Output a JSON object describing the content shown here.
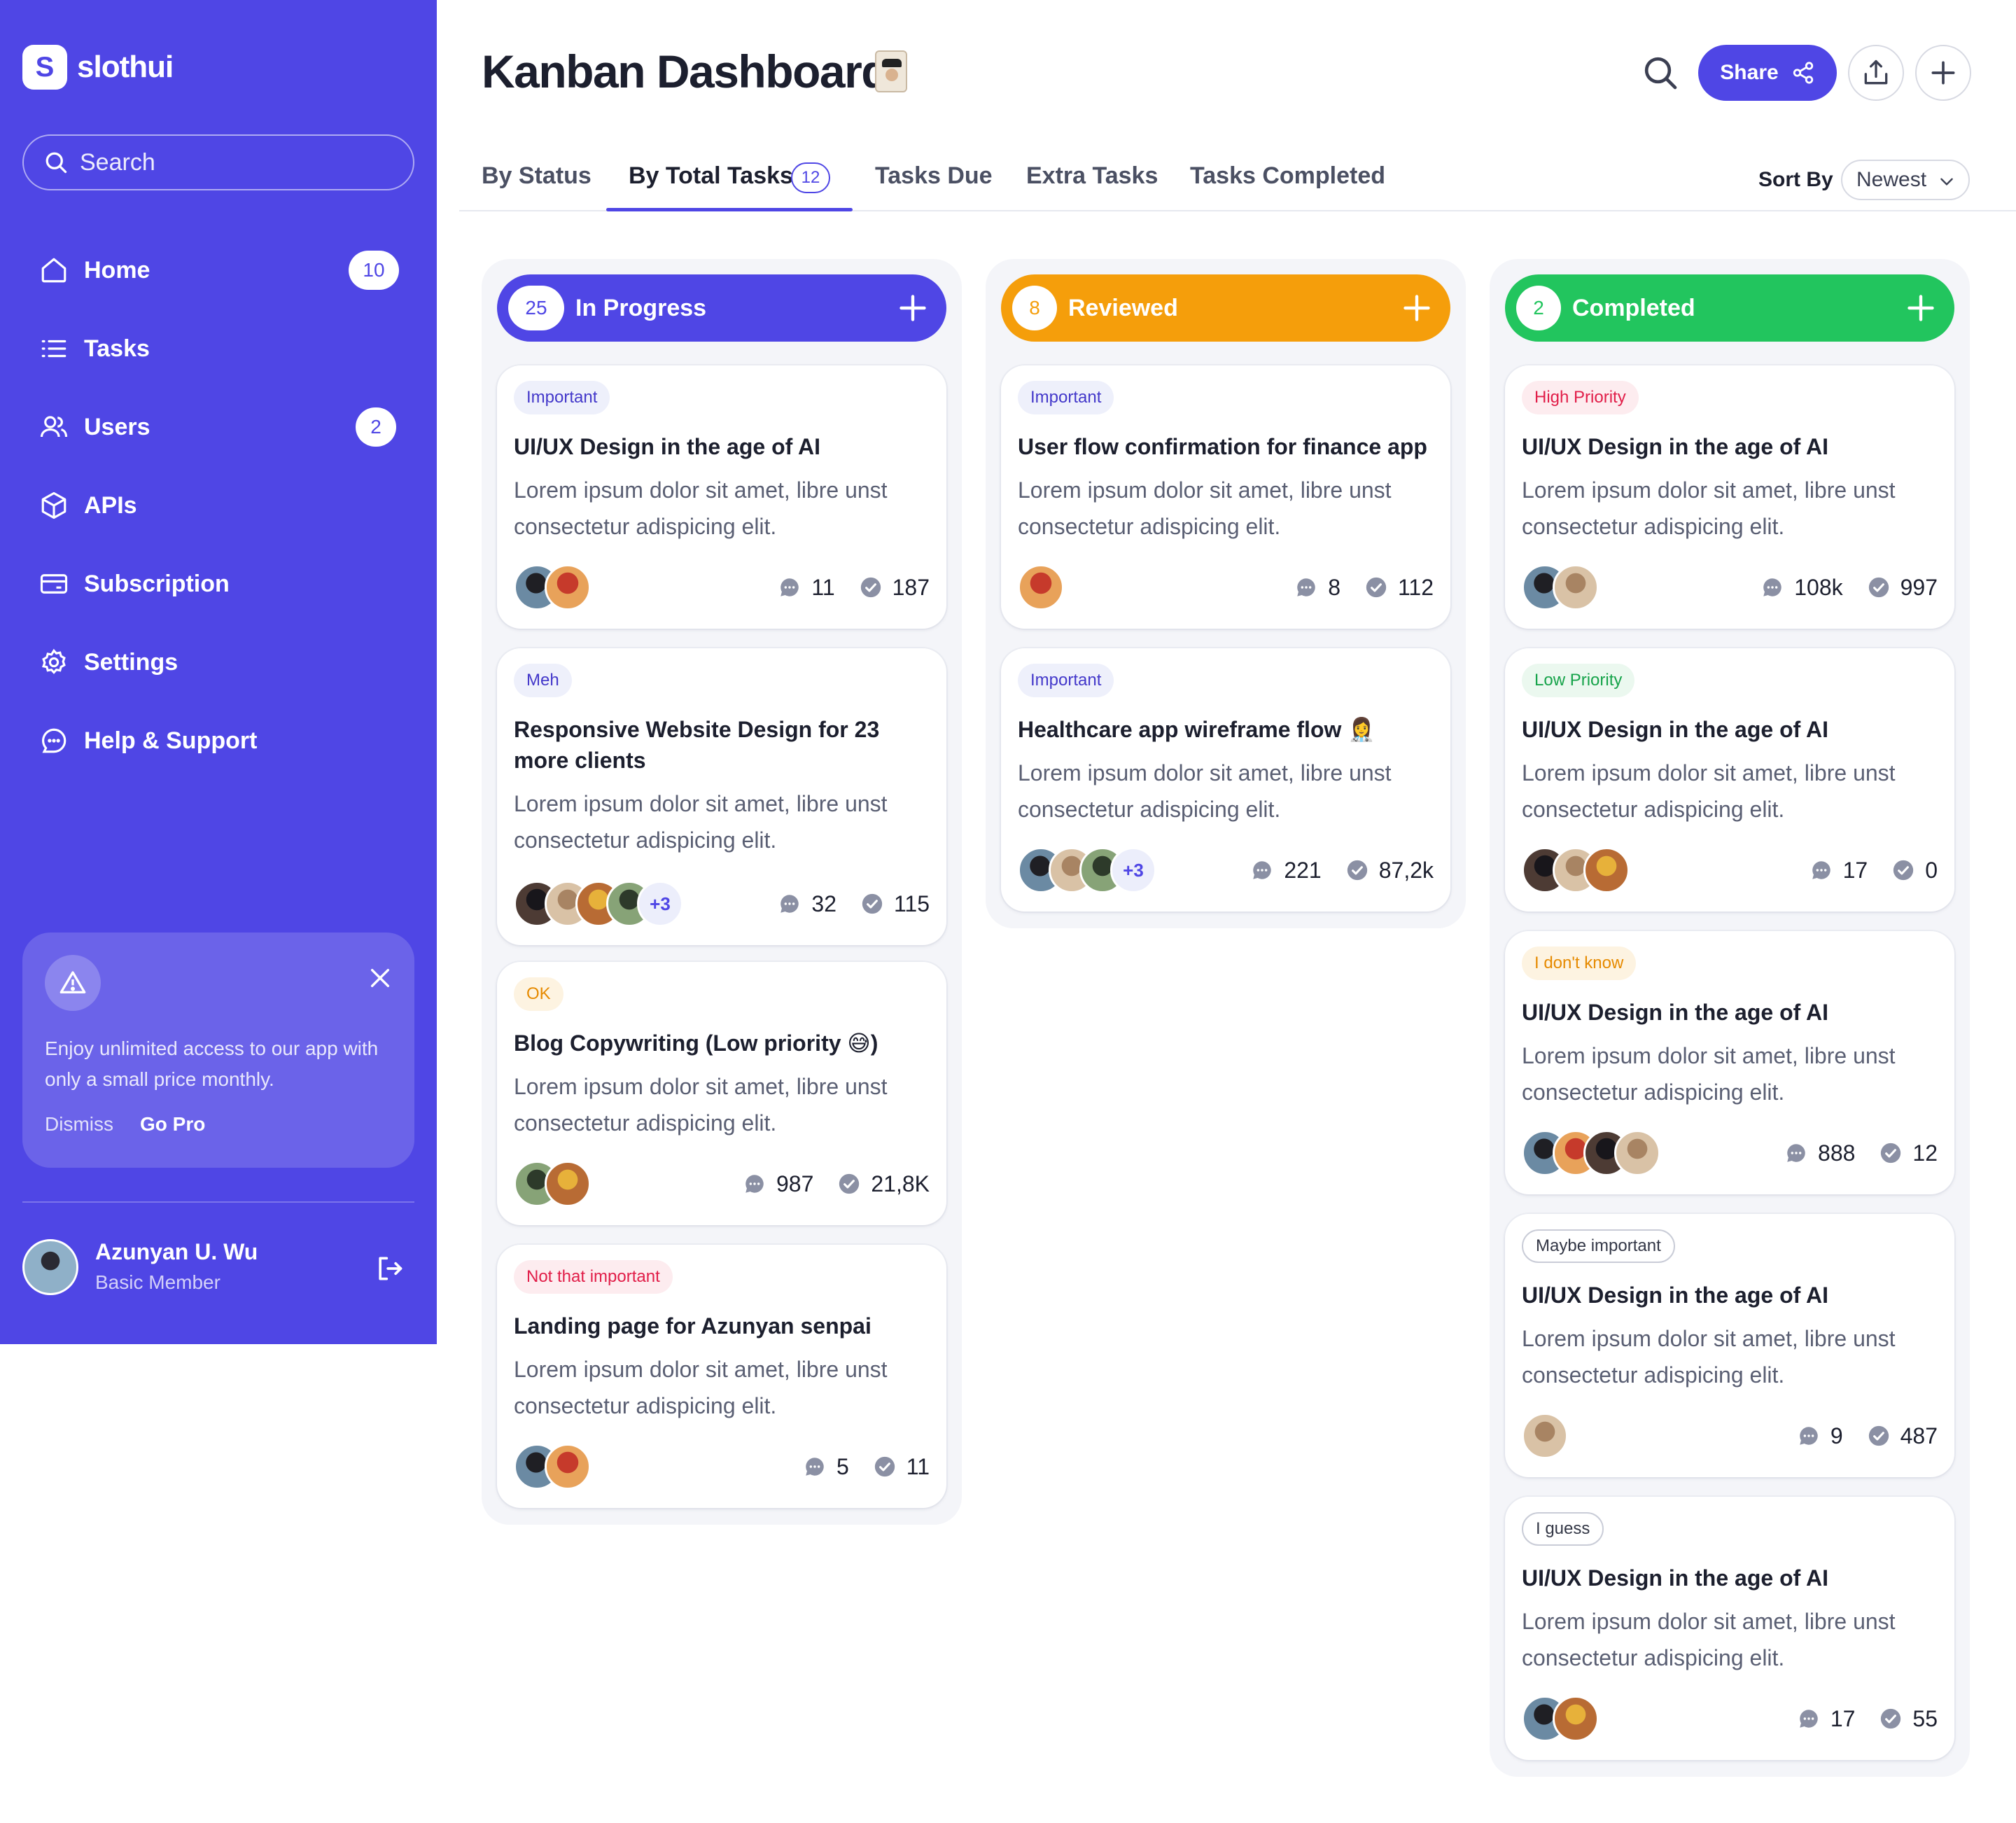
{
  "brand": {
    "logo_letter": "S",
    "name": "slothui"
  },
  "search": {
    "placeholder": "Search"
  },
  "sidebar": {
    "items": [
      {
        "label": "Home",
        "badge": "10",
        "icon": "home-icon"
      },
      {
        "label": "Tasks",
        "badge": "",
        "icon": "list-icon"
      },
      {
        "label": "Users",
        "badge": "2",
        "icon": "users-icon"
      },
      {
        "label": "APIs",
        "badge": "",
        "icon": "cube-icon"
      },
      {
        "label": "Subscription",
        "badge": "",
        "icon": "credit-card-icon"
      },
      {
        "label": "Settings",
        "badge": "",
        "icon": "gear-icon"
      },
      {
        "label": "Help & Support",
        "badge": "",
        "icon": "chat-help-icon"
      }
    ],
    "promo": {
      "message": "Enjoy unlimited access to our app with only a small price monthly.",
      "dismiss": "Dismiss",
      "cta": "Go Pro"
    },
    "user": {
      "name": "Azunyan U. Wu",
      "role": "Basic Member"
    }
  },
  "header": {
    "title": "Kanban Dashboard",
    "share_label": "Share"
  },
  "tabs": {
    "items": [
      "By Status",
      "By Total Tasks",
      "Tasks Due",
      "Extra Tasks",
      "Tasks Completed"
    ],
    "active_count": "12",
    "sort_label": "Sort By",
    "sort_value": "Newest"
  },
  "colors": {
    "accent": "#4f46e5",
    "reviewed": "#f59e0b",
    "completed": "#22c55e"
  },
  "columns": [
    {
      "count": "25",
      "title": "In Progress",
      "cards": [
        {
          "tag": "Important",
          "title": "UI/UX Design in the age of AI",
          "desc": "Lorem ipsum dolor sit amet, libre unst consectetur adispicing elit.",
          "comments": "11",
          "checks": "187",
          "more": ""
        },
        {
          "tag": "Meh",
          "title": "Responsive Website Design for 23 more clients",
          "desc": "Lorem ipsum dolor sit amet, libre unst consectetur adispicing elit.",
          "comments": "32",
          "checks": "115",
          "more": "+3"
        },
        {
          "tag": "OK",
          "title": "Blog Copywriting (Low priority 😅)",
          "desc": "Lorem ipsum dolor sit amet, libre unst consectetur adispicing elit.",
          "comments": "987",
          "checks": "21,8K",
          "more": ""
        },
        {
          "tag": "Not that important",
          "title": "Landing page for Azunyan senpai",
          "desc": "Lorem ipsum dolor sit amet, libre unst consectetur adispicing elit.",
          "comments": "5",
          "checks": "11",
          "more": ""
        }
      ]
    },
    {
      "count": "8",
      "title": "Reviewed",
      "cards": [
        {
          "tag": "Important",
          "title": "User flow confirmation for finance app",
          "desc": "Lorem ipsum dolor sit amet, libre unst consectetur adispicing elit.",
          "comments": "8",
          "checks": "112",
          "more": ""
        },
        {
          "tag": "Important",
          "title": "Healthcare app wireframe flow 👩‍⚕️",
          "desc": "Lorem ipsum dolor sit amet, libre unst consectetur adispicing elit.",
          "comments": "221",
          "checks": "87,2k",
          "more": "+3"
        }
      ]
    },
    {
      "count": "2",
      "title": "Completed",
      "cards": [
        {
          "tag": "High Priority",
          "title": "UI/UX Design in the age of AI",
          "desc": "Lorem ipsum dolor sit amet, libre unst consectetur adispicing elit.",
          "comments": "108k",
          "checks": "997",
          "more": ""
        },
        {
          "tag": "Low Priority",
          "title": "UI/UX Design in the age of AI",
          "desc": "Lorem ipsum dolor sit amet, libre unst consectetur adispicing elit.",
          "comments": "17",
          "checks": "0",
          "more": ""
        },
        {
          "tag": "I don't know",
          "title": "UI/UX Design in the age of AI",
          "desc": "Lorem ipsum dolor sit amet, libre unst consectetur adispicing elit.",
          "comments": "888",
          "checks": "12",
          "more": ""
        },
        {
          "tag": "Maybe important",
          "title": "UI/UX Design in the age of AI",
          "desc": "Lorem ipsum dolor sit amet, libre unst consectetur adispicing elit.",
          "comments": "9",
          "checks": "487",
          "more": ""
        },
        {
          "tag": "I guess",
          "title": "UI/UX Design in the age of AI",
          "desc": "Lorem ipsum dolor sit amet, libre unst consectetur adispicing elit.",
          "comments": "17",
          "checks": "55",
          "more": ""
        }
      ]
    }
  ]
}
